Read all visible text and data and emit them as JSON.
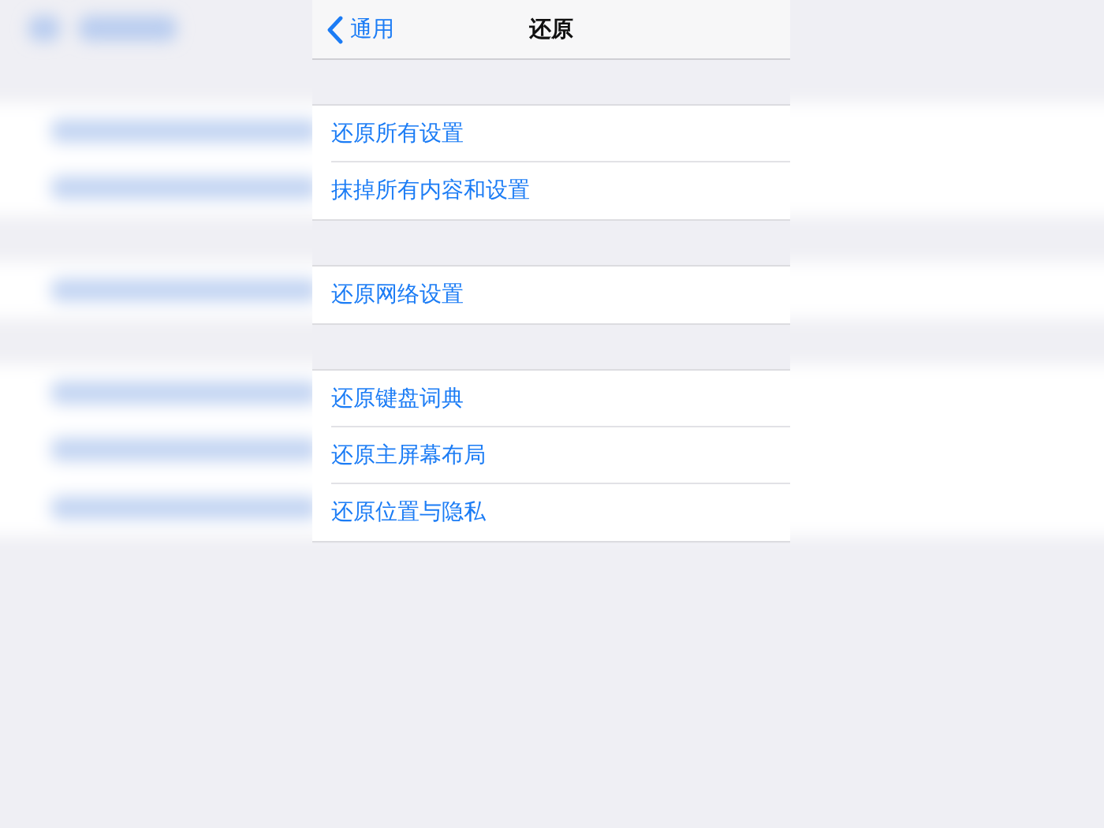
{
  "nav": {
    "back": "通用",
    "title": "还原"
  },
  "groups": [
    {
      "items": [
        "还原所有设置",
        "抹掉所有内容和设置"
      ]
    },
    {
      "items": [
        "还原网络设置"
      ]
    },
    {
      "items": [
        "还原键盘词典",
        "还原主屏幕布局",
        "还原位置与隐私"
      ]
    }
  ]
}
